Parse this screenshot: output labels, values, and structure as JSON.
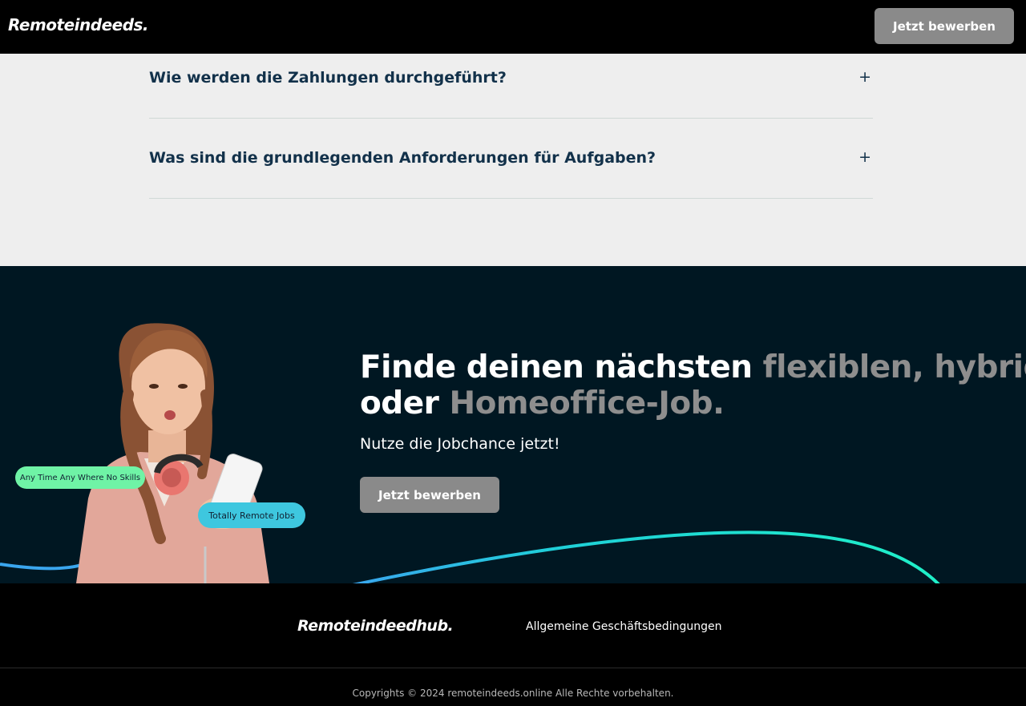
{
  "header": {
    "logo": "Remoteindeeds.",
    "cta_label": "Jetzt bewerben"
  },
  "faq": {
    "items": [
      {
        "question": "Wie werden die Zahlungen durchgeführt?",
        "icon": "+"
      },
      {
        "question": "Was sind die grundlegenden Anforderungen für Aufgaben?",
        "icon": "+"
      }
    ]
  },
  "hero": {
    "headline_part1": "Finde deinen nächsten ",
    "headline_highlight1": "flexiblen, hybriden",
    "headline_part2": "oder ",
    "headline_highlight2": "Homeoffice-Job.",
    "subline": "Nutze die Jobchance jetzt!",
    "cta_label": "Jetzt bewerben",
    "badge1": "Any Time Any Where No Skills",
    "badge2": "Totally Remote Jobs"
  },
  "footer": {
    "logo": "Remoteindeedhub.",
    "link": "Allgemeine Geschäftsbedingungen",
    "copyright": "Copyrights © 2024 remoteindeeds.online Alle Rechte vorbehalten."
  },
  "colors": {
    "header_bg": "#000000",
    "faq_bg": "#eeeeee",
    "faq_text": "#12314a",
    "hero_bg": "#001722",
    "button_bg": "#8a8a8a",
    "highlight_text": "#8e8e8e",
    "badge_green": "#6ff3a6",
    "badge_cyan": "#3ec7df"
  }
}
